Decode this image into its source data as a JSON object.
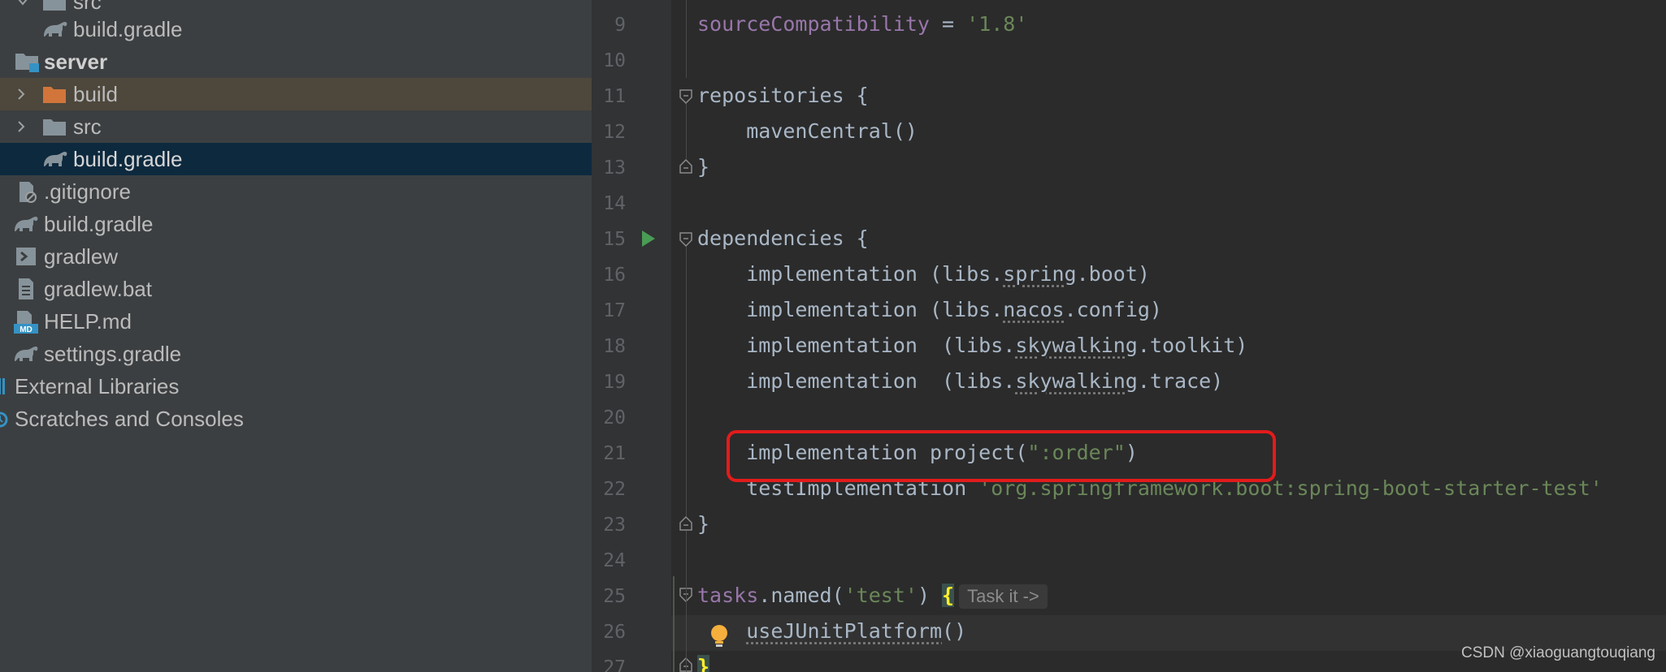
{
  "tree": {
    "items": [
      {
        "label": "src",
        "kind": "folder",
        "expanded": true
      },
      {
        "label": "build.gradle",
        "kind": "gradle"
      },
      {
        "label": "server",
        "kind": "module"
      },
      {
        "label": "build",
        "kind": "folder-orange",
        "expanded": false
      },
      {
        "label": "src",
        "kind": "folder",
        "expanded": false
      },
      {
        "label": "build.gradle",
        "kind": "gradle",
        "selected": true
      },
      {
        "label": ".gitignore",
        "kind": "ignore"
      },
      {
        "label": "build.gradle",
        "kind": "gradle"
      },
      {
        "label": "gradlew",
        "kind": "exec"
      },
      {
        "label": "gradlew.bat",
        "kind": "text"
      },
      {
        "label": "HELP.md",
        "kind": "markdown"
      },
      {
        "label": "settings.gradle",
        "kind": "gradle"
      },
      {
        "label": "External Libraries",
        "kind": "libraries"
      },
      {
        "label": "Scratches and Consoles",
        "kind": "scratches"
      }
    ]
  },
  "editor": {
    "line_numbers": [
      "9",
      "10",
      "11",
      "12",
      "13",
      "14",
      "15",
      "16",
      "17",
      "18",
      "19",
      "20",
      "21",
      "22",
      "23",
      "24",
      "25",
      "26",
      "27"
    ],
    "lines": {
      "l9": {
        "ident": "sourceCompatibility",
        "op": " = ",
        "str": "'1.8'"
      },
      "l11": {
        "a": "repositories ",
        "b": "{"
      },
      "l12": {
        "a": "    mavenCentral()"
      },
      "l13": {
        "a": "}"
      },
      "l15": {
        "a": "dependencies ",
        "b": "{"
      },
      "l16": {
        "a": "    implementation (libs.",
        "b": "spring",
        "c": ".boot)"
      },
      "l17": {
        "a": "    implementation (libs.",
        "b": "nacos",
        "c": ".config)"
      },
      "l18": {
        "a": "    implementation  (libs.",
        "b": "skywalking",
        "c": ".toolkit)"
      },
      "l19": {
        "a": "    implementation  (libs.",
        "b": "skywalking",
        "c": ".trace)"
      },
      "l21": {
        "a": "    implementation project(",
        "str": "\":order\"",
        "c": ")"
      },
      "l22": {
        "a": "    testImplementation ",
        "str": "'org.springframework.boot:spring-boot-starter-test'"
      },
      "l23": {
        "a": "}"
      },
      "l25": {
        "ident": "tasks",
        "a": ".named(",
        "str": "'test'",
        "c": ") ",
        "brace": "{",
        "hint": "Task it ->"
      },
      "l26": {
        "a": "    ",
        "b": "useJUnitPlatform",
        "c": "()"
      },
      "l27": {
        "a": "}"
      }
    }
  },
  "watermark": "CSDN @xiaoguangtouqiang",
  "colors": {
    "tree_bg": "#3c3f41",
    "selected": "#0d293e",
    "highlight": "#4d473c",
    "editor_bg": "#2b2b2b",
    "string": "#6a8759",
    "purple": "#9876aa",
    "run_green": "#499c54",
    "annotation_red": "#e31b1b"
  }
}
